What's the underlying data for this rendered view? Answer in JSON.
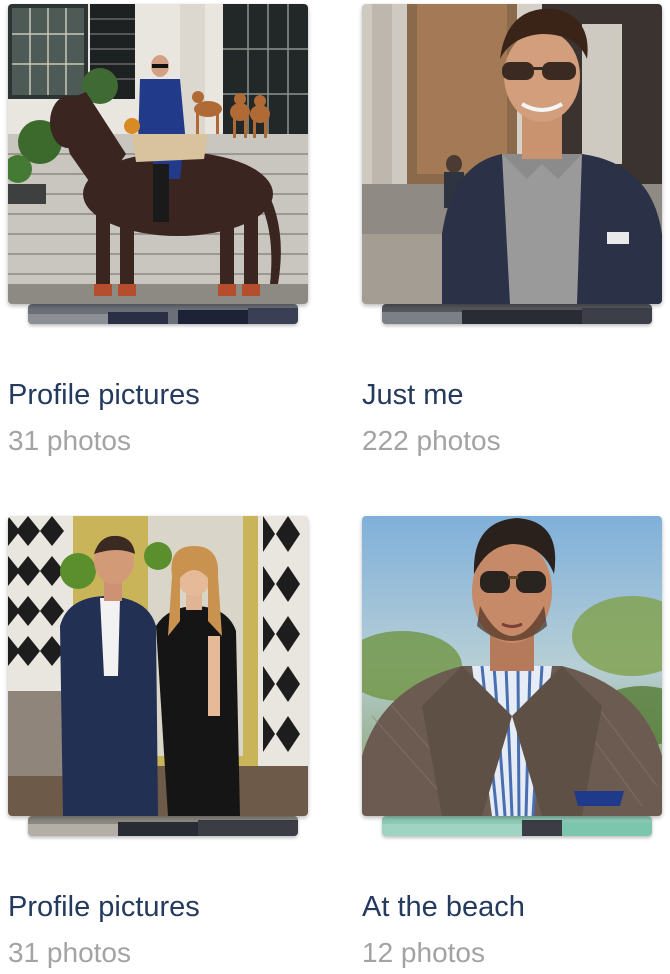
{
  "albums": [
    {
      "title": "Profile pictures",
      "count": "31 photos",
      "cover": "man-on-horse-with-dogs-photo"
    },
    {
      "title": "Just me",
      "count": "222 photos",
      "cover": "smiling-man-sunglasses-blazer-photo"
    },
    {
      "title": "Profile pictures",
      "count": "31 photos",
      "cover": "couple-indoor-photo"
    },
    {
      "title": "At the beach",
      "count": "12 photos",
      "cover": "man-sunglasses-tweed-blazer-photo"
    }
  ],
  "colors": {
    "title": "#243a5e",
    "count": "#a3a3a3"
  }
}
